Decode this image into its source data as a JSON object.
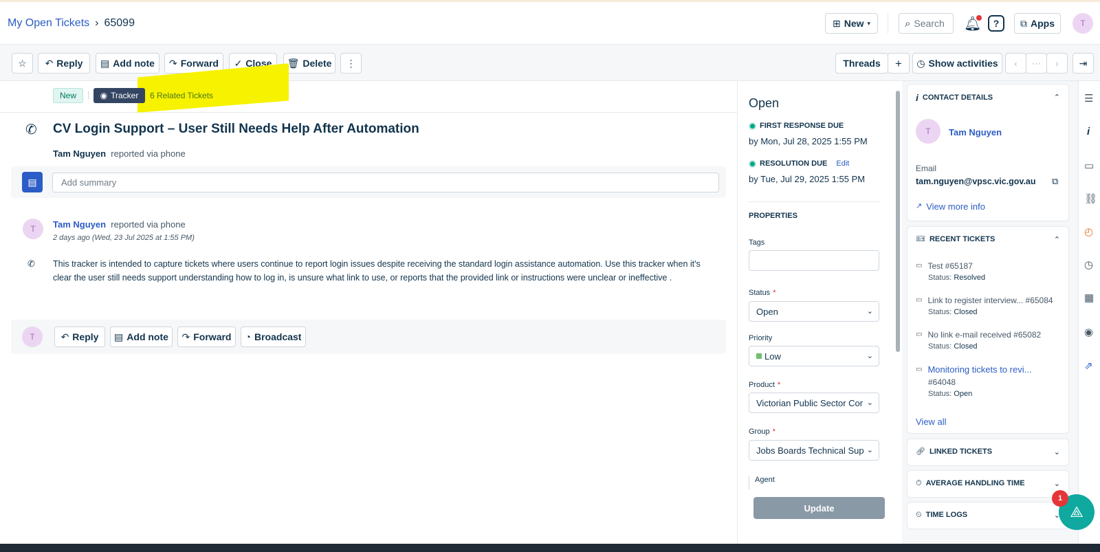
{
  "header": {
    "breadcrumb_parent": "My Open Tickets",
    "breadcrumb_current": "65099",
    "new_label": "New",
    "search_placeholder": "Search",
    "apps_label": "Apps",
    "avatar_initial": "T"
  },
  "toolbar": {
    "reply": "Reply",
    "add_note": "Add note",
    "forward": "Forward",
    "close": "Close",
    "delete": "Delete",
    "threads": "Threads",
    "show_activities": "Show activities"
  },
  "ticket": {
    "status_badge": "New",
    "tracker_badge": "Tracker",
    "related": "6 Related Tickets",
    "title": "CV Login Support – User Still Needs Help After Automation",
    "reporter_name": "Tam Nguyen",
    "reporter_via": "reported via phone",
    "summary_placeholder": "Add summary"
  },
  "message": {
    "avatar_initial": "T",
    "author": "Tam Nguyen",
    "via": "reported via phone",
    "time": "2 days ago (Wed, 23 Jul 2025 at 1:55 PM)",
    "body": "This tracker is intended to capture tickets where users continue to report login issues despite receiving the standard login assistance automation. Use this tracker when it's clear the user still needs support understanding how to log in, is unsure what link to use, or reports that the provided link or instructions were unclear or ineffective ."
  },
  "reply_bar": {
    "avatar_initial": "T",
    "reply": "Reply",
    "add_note": "Add note",
    "forward": "Forward",
    "broadcast": "Broadcast"
  },
  "properties": {
    "status_title": "Open",
    "first_response_label": "FIRST RESPONSE DUE",
    "first_response_value": "by Mon, Jul 28, 2025 1:55 PM",
    "resolution_label": "RESOLUTION DUE",
    "resolution_edit": "Edit",
    "resolution_value": "by Tue, Jul 29, 2025 1:55 PM",
    "section": "PROPERTIES",
    "tags_label": "Tags",
    "status_label": "Status",
    "status_value": "Open",
    "priority_label": "Priority",
    "priority_value": "Low",
    "priority_color": "#6dc06d",
    "product_label": "Product",
    "product_value": "Victorian Public Sector Cor",
    "group_label": "Group",
    "group_value": "Jobs Boards Technical Sup",
    "agent_label": "Agent",
    "update_button": "Update"
  },
  "contact": {
    "heading": "CONTACT DETAILS",
    "avatar_initial": "T",
    "name": "Tam Nguyen",
    "email_label": "Email",
    "email": "tam.nguyen@vpsc.vic.gov.au",
    "view_more": "View more info"
  },
  "recent_tickets": {
    "heading": "RECENT TICKETS",
    "items": [
      {
        "title": "Test #65187",
        "status_label": "Status:",
        "status": "Resolved"
      },
      {
        "title": "Link to register interview... #65084",
        "status_label": "Status:",
        "status": "Closed"
      },
      {
        "title": "No link e-mail received #65082",
        "status_label": "Status:",
        "status": "Closed"
      },
      {
        "title": "Monitoring tickets to revi...",
        "number": "#64048",
        "status_label": "Status:",
        "status": "Open"
      }
    ],
    "view_all": "View all"
  },
  "panels": {
    "linked": "LINKED TICKETS",
    "aht": "AVERAGE HANDLING TIME",
    "time_logs": "TIME LOGS"
  },
  "fab": {
    "badge": "1"
  }
}
